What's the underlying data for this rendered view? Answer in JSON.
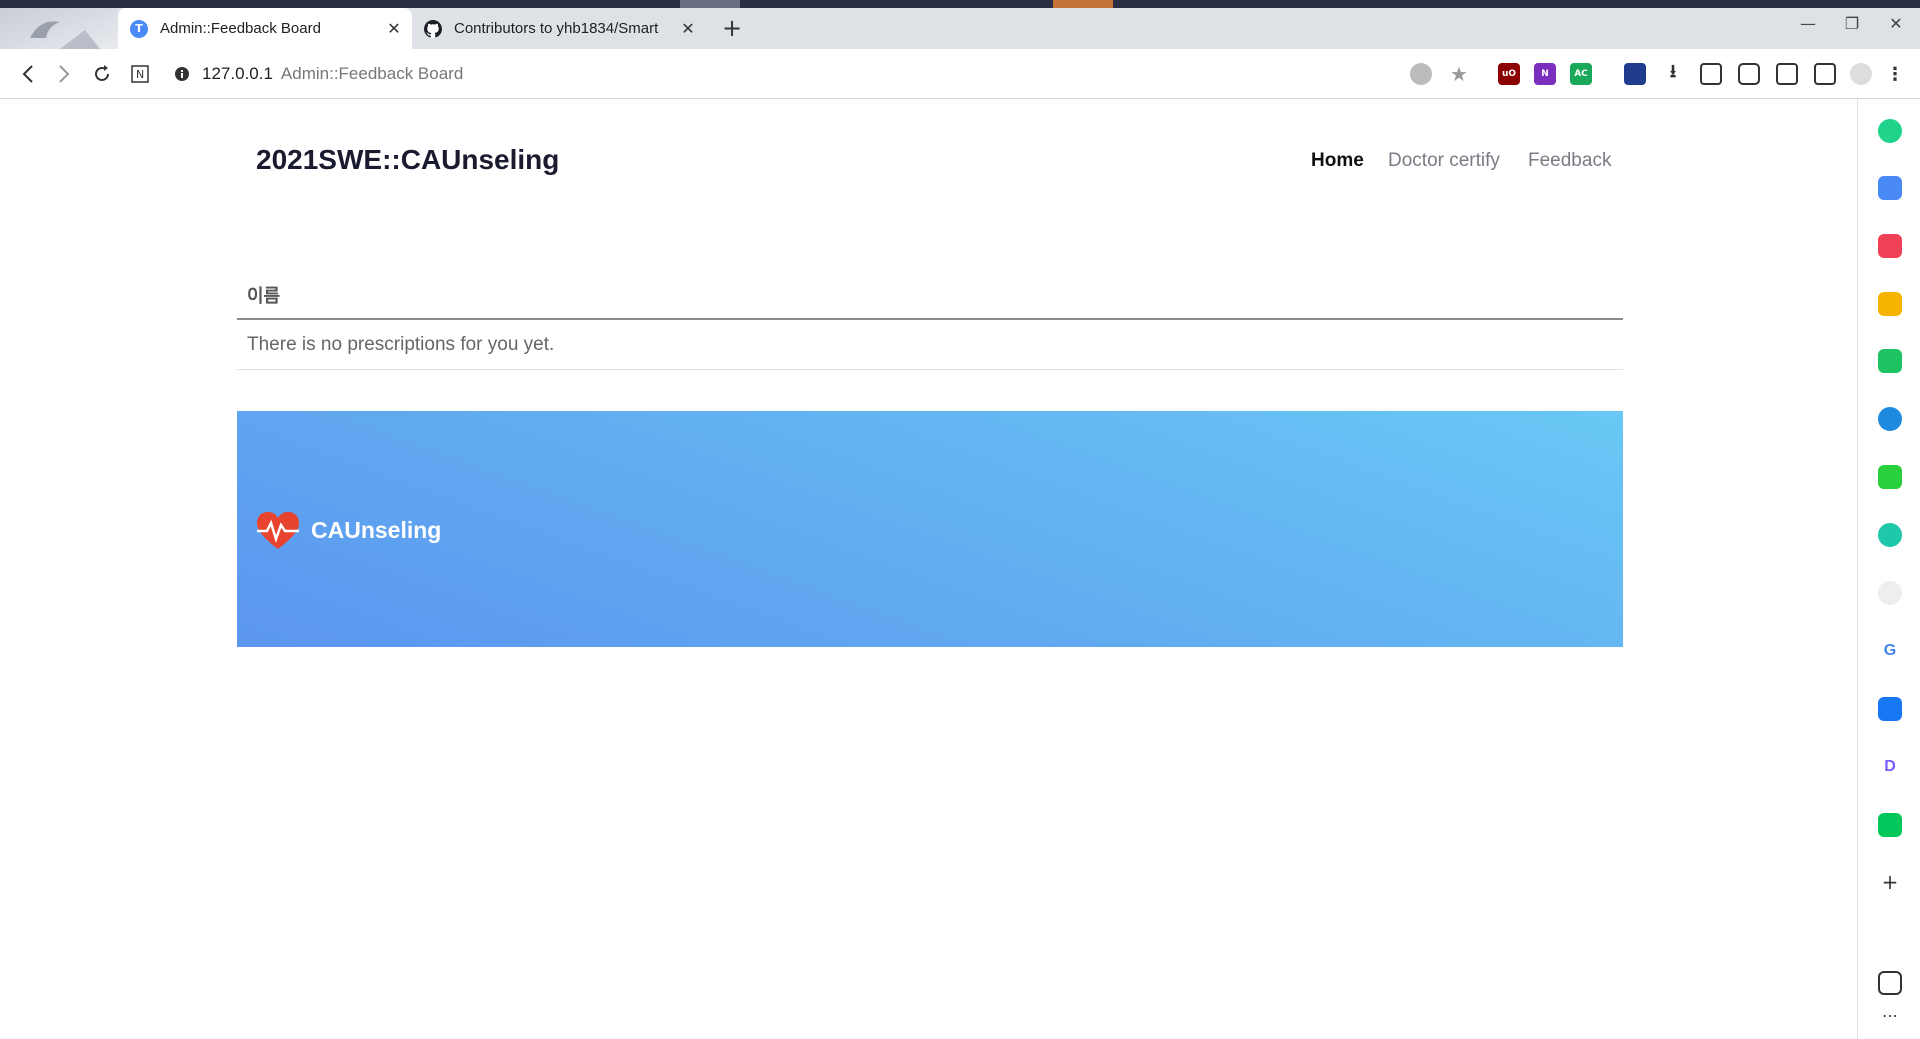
{
  "browser": {
    "tabs": [
      {
        "title": "Admin::Feedback Board",
        "favicon": "T",
        "active": true
      },
      {
        "title": "Contributors to yhb1834/Smart",
        "favicon": "github-icon",
        "active": false
      }
    ],
    "new_tab": "+",
    "address": {
      "host": "127.0.0.1",
      "page_title": "Admin::Feedback Board"
    },
    "window_controls": {
      "minimize": "—",
      "restore": "❐",
      "close": "✕"
    }
  },
  "site": {
    "brand": "2021SWE::CAUnseling",
    "nav": [
      {
        "label": "Home",
        "active": true
      },
      {
        "label": "Doctor certify",
        "active": false
      },
      {
        "label": "Feedback",
        "active": false
      }
    ],
    "table": {
      "column_header": "이름",
      "empty_message": "There is no prescriptions for you yet."
    },
    "banner": {
      "logo": "heart-pulse-icon",
      "name": "CAUnseling"
    }
  },
  "colors": {
    "banner_start": "#5b96ef",
    "banner_end": "#69c8f5",
    "brand_text": "#1b1b2f"
  }
}
